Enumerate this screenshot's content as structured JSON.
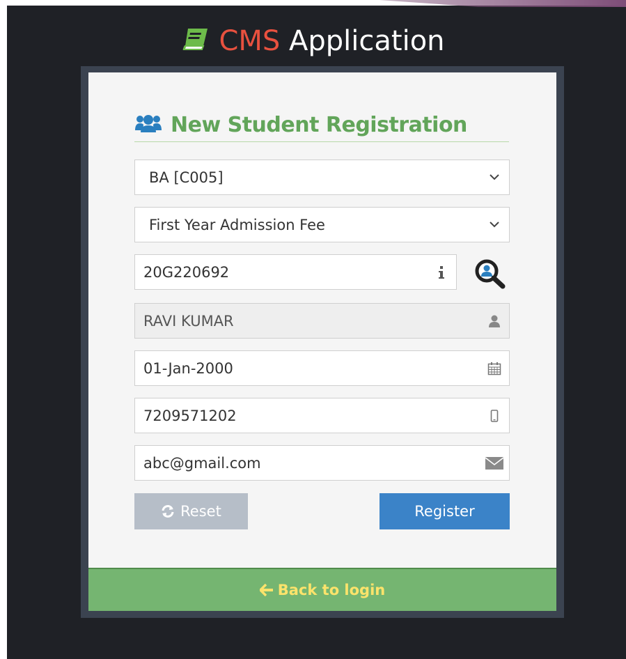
{
  "app": {
    "title_brand": "CMS",
    "title_rest": "Application",
    "icon": "book-icon"
  },
  "form": {
    "heading": "New Student Registration",
    "heading_icon": "users-icon",
    "course_select": {
      "selected": "BA [C005]"
    },
    "fee_select": {
      "selected": "First Year Admission Fee"
    },
    "student_id": {
      "value": "20G220692",
      "addon_icon": "info-icon"
    },
    "search_icon": "search-user-icon",
    "name": {
      "value": "RAVI KUMAR",
      "addon_icon": "user-icon",
      "readonly": true
    },
    "dob": {
      "value": "01-Jan-2000",
      "addon_icon": "calendar-icon"
    },
    "mobile": {
      "value": "7209571202",
      "addon_icon": "mobile-icon"
    },
    "email": {
      "value": "abc@gmail.com",
      "addon_icon": "envelope-icon"
    },
    "reset_label": "Reset",
    "register_label": "Register"
  },
  "footer": {
    "back_label": "Back to login",
    "back_icon": "arrow-left-icon"
  },
  "colors": {
    "background": "#1f2126",
    "brand": "#e8513f",
    "heading": "#62a55a",
    "register": "#3b83c8",
    "reset": "#b6bec8",
    "footer": "#75b571",
    "back_link": "#fce36b"
  }
}
